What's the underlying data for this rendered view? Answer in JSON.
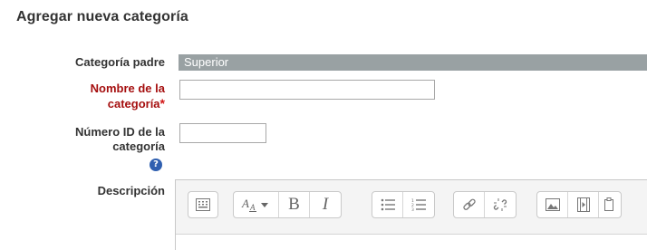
{
  "page": {
    "title": "Agregar nueva categoría"
  },
  "form": {
    "parent": {
      "label": "Categoría padre",
      "value": "Superior"
    },
    "name": {
      "label_line1": "Nombre de la",
      "label_line2": "categoría",
      "required_mark": "*",
      "value": ""
    },
    "idnumber": {
      "label_line1": "Número ID de la",
      "label_line2": "categoría",
      "help_glyph": "?",
      "value": ""
    },
    "description": {
      "label": "Descripción"
    }
  },
  "toolbar": {
    "groups": [
      {
        "name": "toggle",
        "buttons": [
          "toolbar-toggle-icon"
        ]
      },
      {
        "name": "style",
        "buttons": [
          "font-style-icon",
          "bold",
          "italic"
        ]
      },
      {
        "name": "lists",
        "buttons": [
          "unordered-list-icon",
          "ordered-list-icon"
        ]
      },
      {
        "name": "links",
        "buttons": [
          "link-icon",
          "unlink-icon"
        ]
      },
      {
        "name": "media",
        "buttons": [
          "image-icon",
          "video-icon",
          "paste-icon"
        ]
      }
    ],
    "bold_label": "B",
    "italic_label": "I",
    "style_label": "A"
  }
}
